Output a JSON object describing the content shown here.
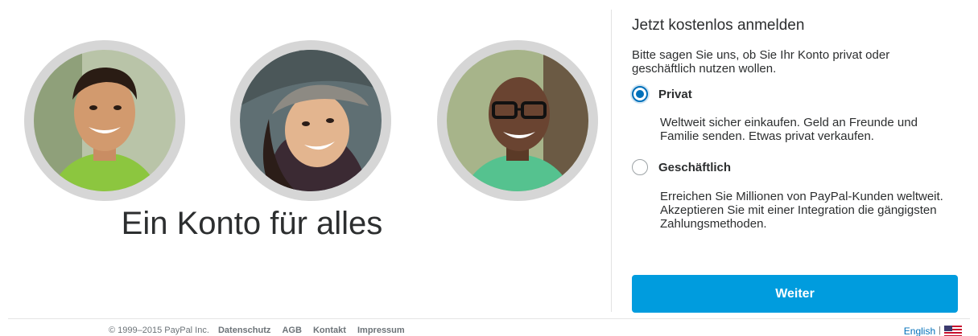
{
  "hero": {
    "title": "Ein Konto für alles",
    "avatars": [
      {
        "icon": "person-photo-smiling-man"
      },
      {
        "icon": "person-photo-woman-with-hat"
      },
      {
        "icon": "person-photo-man-with-glasses"
      }
    ]
  },
  "signup": {
    "title": "Jetzt kostenlos anmelden",
    "intro": "Bitte sagen Sie uns, ob Sie Ihr Konto privat oder geschäftlich nutzen wollen.",
    "options": [
      {
        "label": "Privat",
        "selected": true,
        "description": "Weltweit sicher einkaufen. Geld an Freunde und Familie senden. Etwas privat verkaufen."
      },
      {
        "label": "Geschäftlich",
        "selected": false,
        "description": "Erreichen Sie Millionen von PayPal-Kunden weltweit. Akzeptieren Sie mit einer Integration die gängigsten Zahlungsmethoden."
      }
    ],
    "continue_label": "Weiter"
  },
  "footer": {
    "copyright": "© 1999–2015 PayPal Inc.",
    "links": [
      "Datenschutz",
      "AGB",
      "Kontakt",
      "Impressum"
    ],
    "language_label": "English",
    "separator": "|",
    "flag_icon": "us-flag-icon"
  },
  "colors": {
    "accent": "#0070ba",
    "button": "#009cde",
    "text": "#2c2e2f"
  }
}
